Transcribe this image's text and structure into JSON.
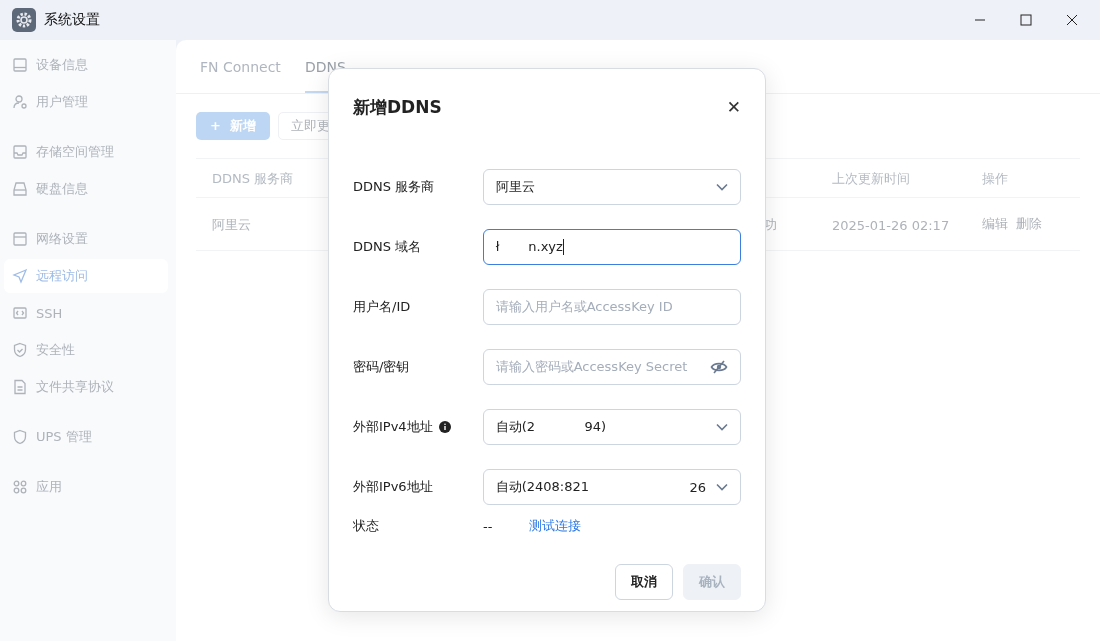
{
  "window": {
    "title": "系统设置"
  },
  "sidebar": {
    "groups": [
      {
        "items": [
          {
            "label": "设备信息",
            "selected": false
          },
          {
            "label": "用户管理",
            "selected": false
          }
        ]
      },
      {
        "items": [
          {
            "label": "存储空间管理",
            "selected": false
          },
          {
            "label": "硬盘信息",
            "selected": false
          }
        ]
      },
      {
        "items": [
          {
            "label": "网络设置",
            "selected": false
          },
          {
            "label": "远程访问",
            "selected": true
          },
          {
            "label": "SSH",
            "selected": false
          },
          {
            "label": "安全性",
            "selected": false
          },
          {
            "label": "文件共享协议",
            "selected": false
          }
        ]
      },
      {
        "items": [
          {
            "label": "UPS 管理",
            "selected": false
          }
        ]
      },
      {
        "items": [
          {
            "label": "应用",
            "selected": false
          }
        ]
      }
    ]
  },
  "tabs": [
    {
      "label": "FN Connect",
      "selected": false
    },
    {
      "label": "DDNS",
      "selected": true
    }
  ],
  "toolbar": {
    "add_button": {
      "icon": "+",
      "label": "新增"
    },
    "update_button": "立即更"
  },
  "table": {
    "headers": {
      "provider": "DDNS 服务商",
      "updated": "上次更新时间",
      "actions": "操作"
    },
    "rows": [
      {
        "provider": "阿里云",
        "status": "功",
        "updated": "2025-01-26 02:17",
        "actions": [
          "编辑",
          "删除"
        ]
      }
    ]
  },
  "dialog": {
    "title": "新增DDNS",
    "close": "✕",
    "fields": [
      {
        "kind": "select",
        "label": "DDNS 服务商",
        "value": "阿里云",
        "focused": false,
        "info_icon": false
      },
      {
        "kind": "input",
        "label": "DDNS 域名",
        "value": "ł       n.xyz",
        "focused": true,
        "info_icon": false
      },
      {
        "kind": "input",
        "label": "用户名/ID",
        "placeholder": "请输入用户名或AccessKey ID",
        "focused": false,
        "info_icon": false
      },
      {
        "kind": "password",
        "label": "密码/密钥",
        "placeholder": "请输入密码或AccessKey Secret",
        "focused": false,
        "info_icon": false
      },
      {
        "kind": "select",
        "label": "外部IPv4地址",
        "value": "自动(2            94)",
        "focused": false,
        "info_icon": true
      },
      {
        "kind": "select",
        "label": "外部IPv6地址",
        "value": "自动(2408:821",
        "value_end": "26",
        "focused": false,
        "info_icon": false
      }
    ],
    "status": {
      "label": "状态",
      "value": "--",
      "link": "测试连接"
    },
    "buttons": [
      {
        "label": "取消",
        "disabled": false
      },
      {
        "label": "确认",
        "disabled": true
      }
    ]
  }
}
